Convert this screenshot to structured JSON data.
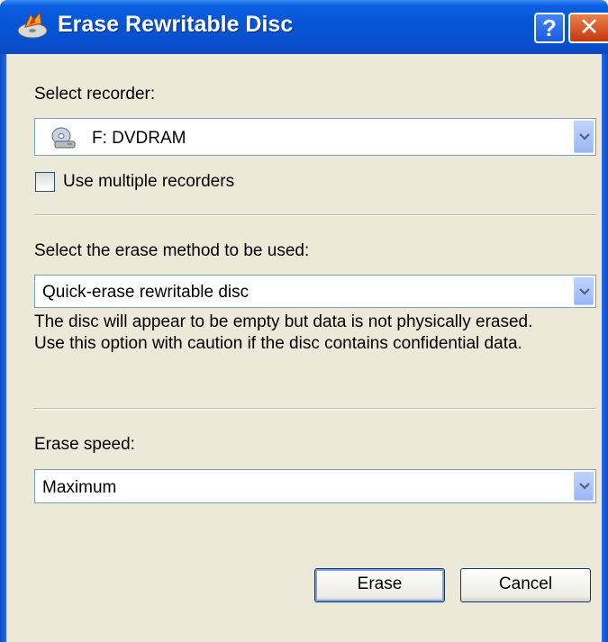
{
  "window": {
    "title": "Erase Rewritable Disc",
    "help_glyph": "?",
    "close_glyph": "✕"
  },
  "recorder": {
    "label": "Select recorder:",
    "selected": "F: DVDRAM",
    "icon": "dvd-drive-icon",
    "multiple_label": "Use multiple recorders",
    "multiple_checked": false
  },
  "erase_method": {
    "label": "Select the erase method to be used:",
    "selected": "Quick-erase rewritable disc",
    "description_line1": "The disc will appear to be empty but data is not physically erased.",
    "description_line2": "Use this option with caution if the disc contains confidential data."
  },
  "erase_speed": {
    "label": "Erase speed:",
    "selected": "Maximum"
  },
  "buttons": {
    "erase": "Erase",
    "cancel": "Cancel"
  },
  "colors": {
    "titlebar": "#0555D7",
    "dialog_bg": "#ECE9D8",
    "accent": "#7BA2E7"
  }
}
